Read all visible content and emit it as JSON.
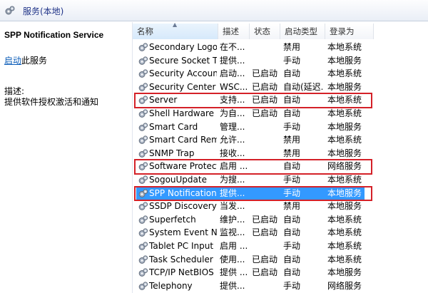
{
  "window": {
    "title": "服务(本地)"
  },
  "left_pane": {
    "service_name": "SPP Notification Service",
    "start_link": "启动",
    "start_suffix": "此服务",
    "desc_label": "描述:",
    "desc_text": "提供软件授权激活和通知"
  },
  "columns": {
    "name": "名称",
    "desc": "描述",
    "status": "状态",
    "start_type": "启动类型",
    "logon": "登录为"
  },
  "rows": [
    {
      "name": "Secondary Logon",
      "desc": "在不...",
      "status": "",
      "start_type": "禁用",
      "logon": "本地系统"
    },
    {
      "name": "Secure Socket T...",
      "desc": "提供...",
      "status": "",
      "start_type": "手动",
      "logon": "本地服务"
    },
    {
      "name": "Security Account...",
      "desc": "启动...",
      "status": "已启动",
      "start_type": "自动",
      "logon": "本地系统"
    },
    {
      "name": "Security Center",
      "desc": "WSC...",
      "status": "已启动",
      "start_type": "自动(延迟...",
      "logon": "本地服务"
    },
    {
      "name": "Server",
      "desc": "支持...",
      "status": "已启动",
      "start_type": "自动",
      "logon": "本地系统"
    },
    {
      "name": "Shell Hardware ...",
      "desc": "为自...",
      "status": "已启动",
      "start_type": "自动",
      "logon": "本地系统"
    },
    {
      "name": "Smart Card",
      "desc": "管理...",
      "status": "",
      "start_type": "手动",
      "logon": "本地服务"
    },
    {
      "name": "Smart Card Rem...",
      "desc": "允许...",
      "status": "",
      "start_type": "禁用",
      "logon": "本地系统"
    },
    {
      "name": "SNMP Trap",
      "desc": "接收...",
      "status": "",
      "start_type": "禁用",
      "logon": "本地服务"
    },
    {
      "name": "Software Protect...",
      "desc": "启用 ...",
      "status": "",
      "start_type": "自动",
      "logon": "网络服务"
    },
    {
      "name": "SogouUpdate",
      "desc": "为搜...",
      "status": "",
      "start_type": "手动",
      "logon": "本地系统"
    },
    {
      "name": "SPP Notification ...",
      "desc": "提供...",
      "status": "",
      "start_type": "手动",
      "logon": "本地服务"
    },
    {
      "name": "SSDP Discovery",
      "desc": "当发...",
      "status": "",
      "start_type": "禁用",
      "logon": "本地服务"
    },
    {
      "name": "Superfetch",
      "desc": "维护...",
      "status": "已启动",
      "start_type": "自动",
      "logon": "本地系统"
    },
    {
      "name": "System Event N...",
      "desc": "监视...",
      "status": "已启动",
      "start_type": "自动",
      "logon": "本地系统"
    },
    {
      "name": "Tablet PC Input ...",
      "desc": "启用 ...",
      "status": "",
      "start_type": "手动",
      "logon": "本地系统"
    },
    {
      "name": "Task Scheduler",
      "desc": "使用...",
      "status": "已启动",
      "start_type": "自动",
      "logon": "本地系统"
    },
    {
      "name": "TCP/IP NetBIOS ...",
      "desc": "提供 ...",
      "status": "已启动",
      "start_type": "自动",
      "logon": "本地服务"
    },
    {
      "name": "Telephony",
      "desc": "提供...",
      "status": "",
      "start_type": "手动",
      "logon": "网络服务"
    }
  ],
  "selected_row": 11,
  "highlighted_rows": [
    4,
    9,
    11
  ],
  "colors": {
    "selection": "#3399ff",
    "highlight_box": "#d42128",
    "link": "#0b5cb8"
  },
  "icons": {
    "row": "gear-icon",
    "header": "services-gear-icon"
  }
}
